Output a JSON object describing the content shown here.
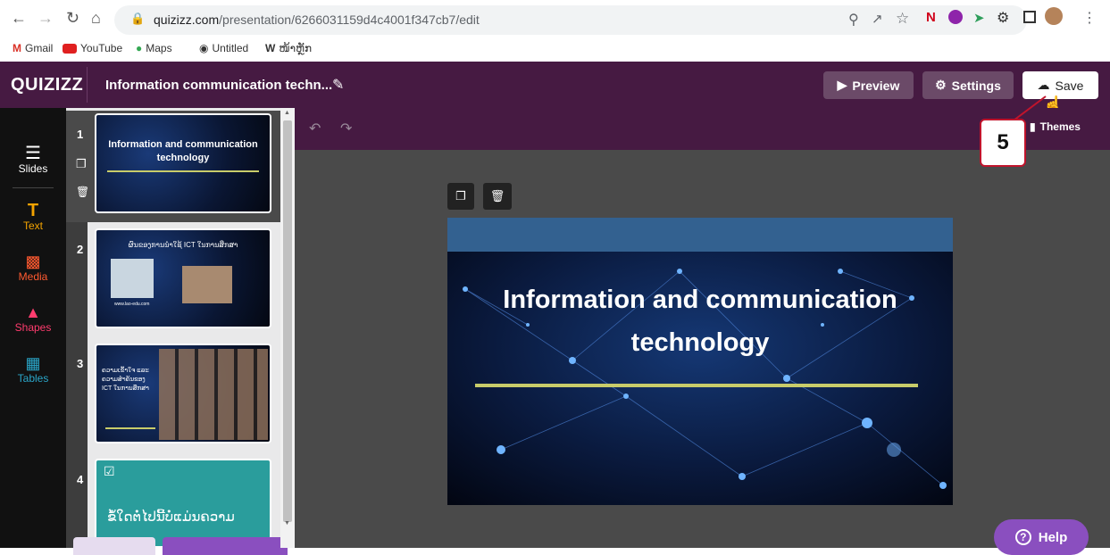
{
  "browser": {
    "url_host": "quizizz.com",
    "url_path": "/presentation/6266031159d4c4001f347cb7/edit",
    "bookmarks": [
      "Gmail",
      "YouTube",
      "Maps",
      "Untitled",
      "ໜ້າຫຼັກ"
    ]
  },
  "app": {
    "logo": "QUIZIZZ",
    "title": "Information communication techn...",
    "preview_label": "Preview",
    "settings_label": "Settings",
    "save_label": "Save",
    "themes_label": "Themes"
  },
  "annotation": {
    "step": "5"
  },
  "tools": [
    {
      "label": "Slides"
    },
    {
      "label": "Text"
    },
    {
      "label": "Media"
    },
    {
      "label": "Shapes"
    },
    {
      "label": "Tables"
    }
  ],
  "slides": [
    {
      "num": "1",
      "title": "Information and communication technology"
    },
    {
      "num": "2",
      "title": "ຜົນຂອງການນຳໃຊ້ ICT ໃນການສຶກສາ",
      "footer": "www.lao-edu.com"
    },
    {
      "num": "3",
      "title": "ຄວາມເຂົ້າໃຈ ແລະ ຄວາມສຳຄັນຂອງ ICT ໃນການສຶກສາ"
    },
    {
      "num": "4",
      "title": "ຂໍ້ໃດຕໍ່ໄປນີ້ບໍ່ແມ່ນຄວາມ"
    }
  ],
  "current_slide": {
    "title_line1": "Information and communication",
    "title_line2": "technology"
  },
  "help_label": "Help",
  "colors": {
    "brand": "#461a42",
    "accent_yellow": "#c8cc6a",
    "slide4_bg": "#2a9d9c"
  }
}
